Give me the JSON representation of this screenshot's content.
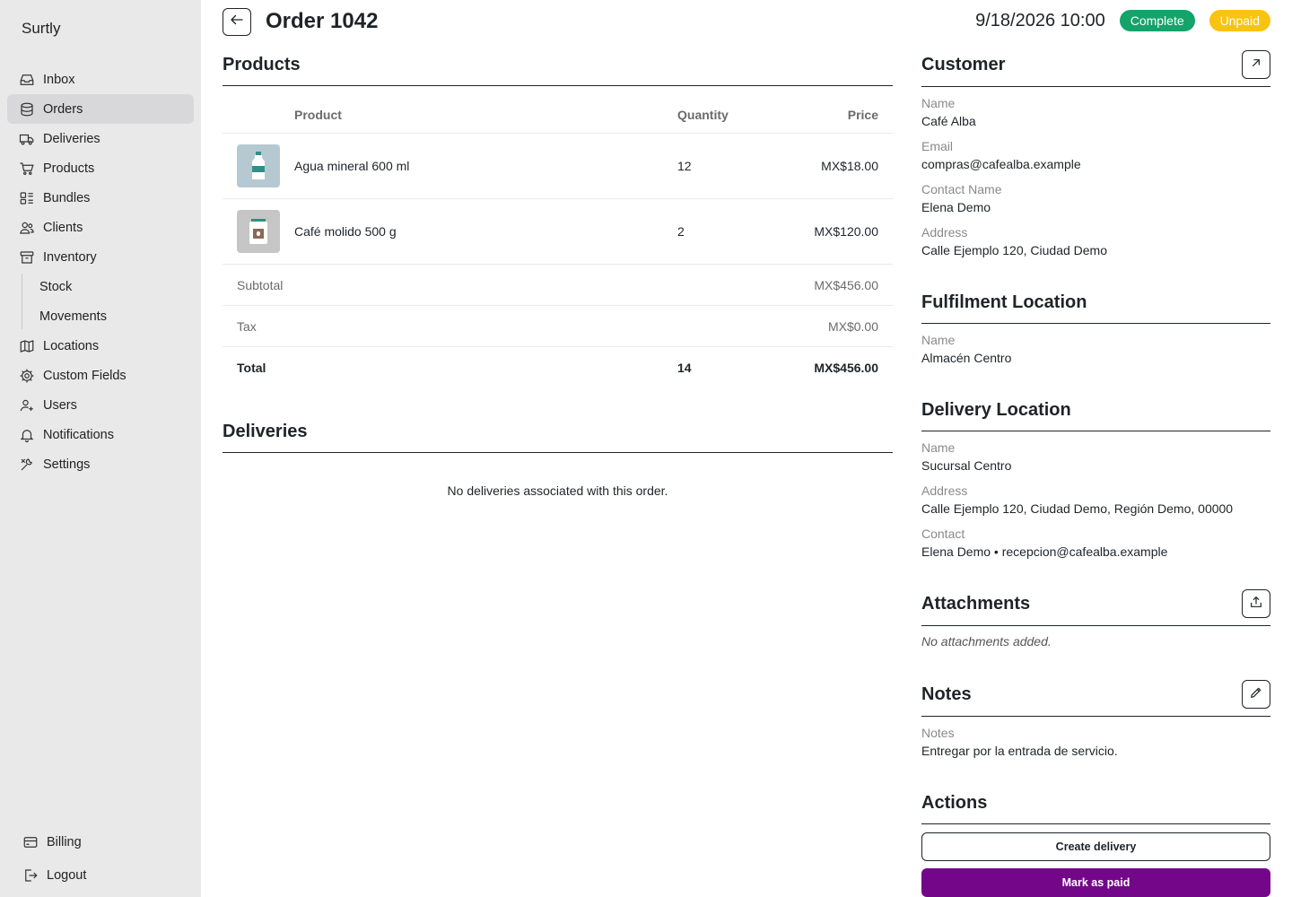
{
  "app": {
    "brand": "Surtly"
  },
  "sidebar": {
    "items": [
      {
        "label": "Inbox",
        "icon": "inbox-icon"
      },
      {
        "label": "Orders",
        "icon": "database-icon",
        "active": true
      },
      {
        "label": "Deliveries",
        "icon": "truck-icon"
      },
      {
        "label": "Products",
        "icon": "cart-icon"
      },
      {
        "label": "Bundles",
        "icon": "bundles-icon"
      },
      {
        "label": "Clients",
        "icon": "users-icon"
      },
      {
        "label": "Inventory",
        "icon": "archive-icon"
      }
    ],
    "inventory_sub": [
      {
        "label": "Stock"
      },
      {
        "label": "Movements"
      }
    ],
    "items_after": [
      {
        "label": "Locations",
        "icon": "map-icon"
      },
      {
        "label": "Custom Fields",
        "icon": "cog-icon"
      },
      {
        "label": "Users",
        "icon": "user-plus-icon"
      },
      {
        "label": "Notifications",
        "icon": "bell-icon"
      },
      {
        "label": "Settings",
        "icon": "wrench-icon"
      }
    ],
    "bottom": [
      {
        "label": "Billing",
        "icon": "credit-card-icon"
      },
      {
        "label": "Logout",
        "icon": "logout-icon"
      }
    ]
  },
  "header": {
    "title": "Order 1042",
    "datetime": "9/18/2026 10:00",
    "status_badge": "Complete",
    "payment_badge": "Unpaid",
    "colors": {
      "complete": "#14a36b",
      "unpaid": "#fac310"
    }
  },
  "products": {
    "title": "Products",
    "columns": {
      "product": "Product",
      "quantity": "Quantity",
      "price": "Price"
    },
    "rows": [
      {
        "name": "Agua mineral 600 ml",
        "quantity": "12",
        "price": "MX$18.00",
        "thumb": "water-bottle-icon"
      },
      {
        "name": "Café molido 500 g",
        "quantity": "2",
        "price": "MX$120.00",
        "thumb": "coffee-bag-icon"
      }
    ],
    "subtotal_label": "Subtotal",
    "subtotal": "MX$456.00",
    "tax_label": "Tax",
    "tax": "MX$0.00",
    "total_label": "Total",
    "total_qty": "14",
    "total": "MX$456.00"
  },
  "deliveries": {
    "title": "Deliveries",
    "empty": "No deliveries associated with this order."
  },
  "customer": {
    "title": "Customer",
    "name_label": "Name",
    "name": "Café Alba",
    "email_label": "Email",
    "email": "compras@cafealba.example",
    "contact_label": "Contact Name",
    "contact": "Elena Demo",
    "address_label": "Address",
    "address": "Calle Ejemplo 120, Ciudad Demo"
  },
  "fulfilment": {
    "title": "Fulfilment Location",
    "name_label": "Name",
    "name": "Almacén Centro"
  },
  "delivery_location": {
    "title": "Delivery Location",
    "name_label": "Name",
    "name": "Sucursal Centro",
    "address_label": "Address",
    "address": "Calle Ejemplo 120, Ciudad Demo, Región Demo, 00000",
    "contact_label": "Contact",
    "contact": "Elena Demo • recepcion@cafealba.example"
  },
  "attachments": {
    "title": "Attachments",
    "empty": "No attachments added."
  },
  "notes": {
    "title": "Notes",
    "label": "Notes",
    "value": "Entregar por la entrada de servicio."
  },
  "actions": {
    "title": "Actions",
    "create_delivery": "Create delivery",
    "mark_paid": "Mark as paid",
    "primary_color": "#74068a"
  }
}
